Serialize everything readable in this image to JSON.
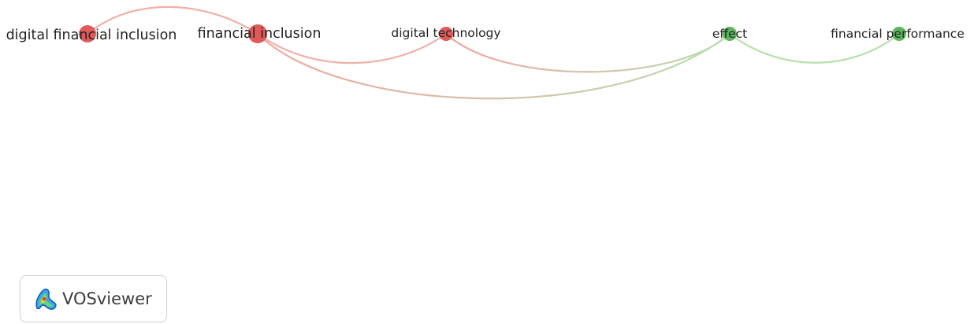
{
  "network": {
    "colors": {
      "cluster_1": "#e05a5a",
      "cluster_2": "#5cb85c"
    },
    "nodes": [
      {
        "id": "dfi",
        "label": "digital financial inclusion",
        "cluster": 1
      },
      {
        "id": "fi",
        "label": "financial inclusion",
        "cluster": 1
      },
      {
        "id": "dt",
        "label": "digital technology",
        "cluster": 1
      },
      {
        "id": "ef",
        "label": "effect",
        "cluster": 2
      },
      {
        "id": "fp",
        "label": "financial performance",
        "cluster": 2
      }
    ],
    "links": [
      {
        "from": "dfi",
        "to": "fi"
      },
      {
        "from": "fi",
        "to": "dt"
      },
      {
        "from": "fi",
        "to": "ef"
      },
      {
        "from": "dt",
        "to": "ef"
      },
      {
        "from": "ef",
        "to": "fp"
      }
    ]
  },
  "logo": {
    "text": "VOSviewer",
    "icon": "vosviewer-logo-icon"
  }
}
